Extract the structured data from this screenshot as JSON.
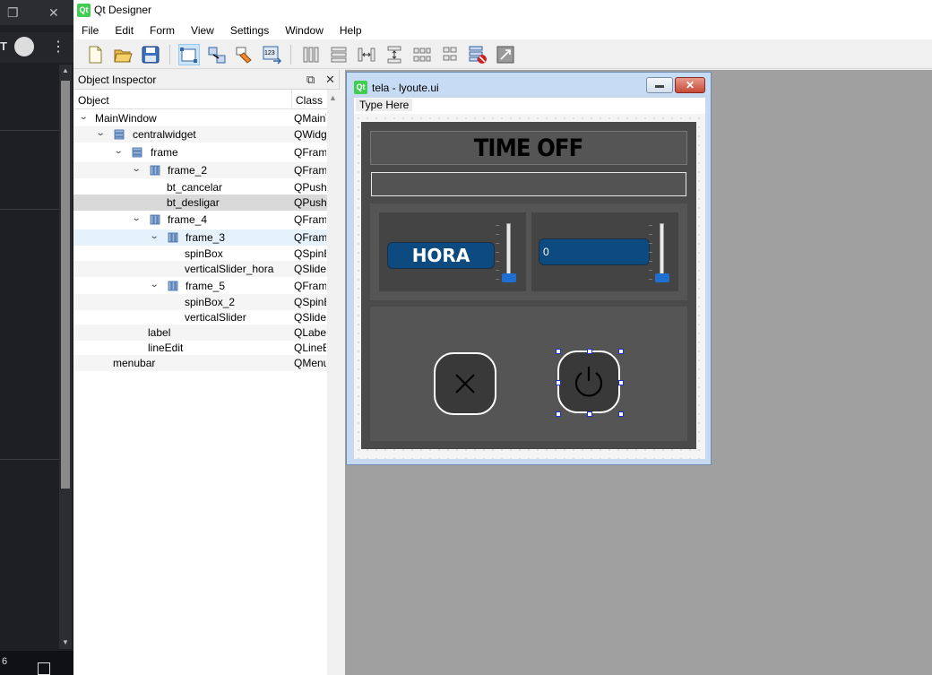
{
  "app": {
    "title": "Qt Designer",
    "logo_text": "Qt"
  },
  "menubar": {
    "items": [
      "File",
      "Edit",
      "Form",
      "View",
      "Settings",
      "Window",
      "Help"
    ]
  },
  "toolbar": {
    "icons": [
      "new-form-icon",
      "open-form-icon",
      "save-form-icon",
      "edit-widgets-icon",
      "edit-signals-slots-icon",
      "edit-buddies-icon",
      "edit-tab-order-icon",
      "layout-horizontal-icon",
      "layout-vertical-icon",
      "layout-horizontal-splitter-icon",
      "layout-vertical-splitter-icon",
      "layout-grid-icon",
      "layout-form-icon",
      "break-layout-icon",
      "adjust-size-icon"
    ]
  },
  "object_inspector": {
    "title": "Object Inspector",
    "col_object": "Object",
    "col_class": "Class",
    "rows": [
      {
        "name": "MainWindow",
        "class": "QMainWindow"
      },
      {
        "name": "centralwidget",
        "class": "QWidget"
      },
      {
        "name": "frame",
        "class": "QFrame"
      },
      {
        "name": "frame_2",
        "class": "QFrame"
      },
      {
        "name": "bt_cancelar",
        "class": "QPushButton"
      },
      {
        "name": "bt_desligar",
        "class": "QPushButton"
      },
      {
        "name": "frame_4",
        "class": "QFrame"
      },
      {
        "name": "frame_3",
        "class": "QFrame"
      },
      {
        "name": "spinBox",
        "class": "QSpinBox"
      },
      {
        "name": "verticalSlider_hora",
        "class": "QSlider"
      },
      {
        "name": "frame_5",
        "class": "QFrame"
      },
      {
        "name": "spinBox_2",
        "class": "QSpinBox"
      },
      {
        "name": "verticalSlider",
        "class": "QSlider"
      },
      {
        "name": "label",
        "class": "QLabel"
      },
      {
        "name": "lineEdit",
        "class": "QLineEdit"
      },
      {
        "name": "menubar",
        "class": "QMenuBar"
      }
    ]
  },
  "form_window": {
    "title": "tela - lyoute.ui",
    "menu_placeholder": "Type Here",
    "label_text": "TIME OFF",
    "spinbox_text": "HORA",
    "spinbox2_value": "0"
  },
  "left_panel": {
    "bottom_text": "6"
  }
}
